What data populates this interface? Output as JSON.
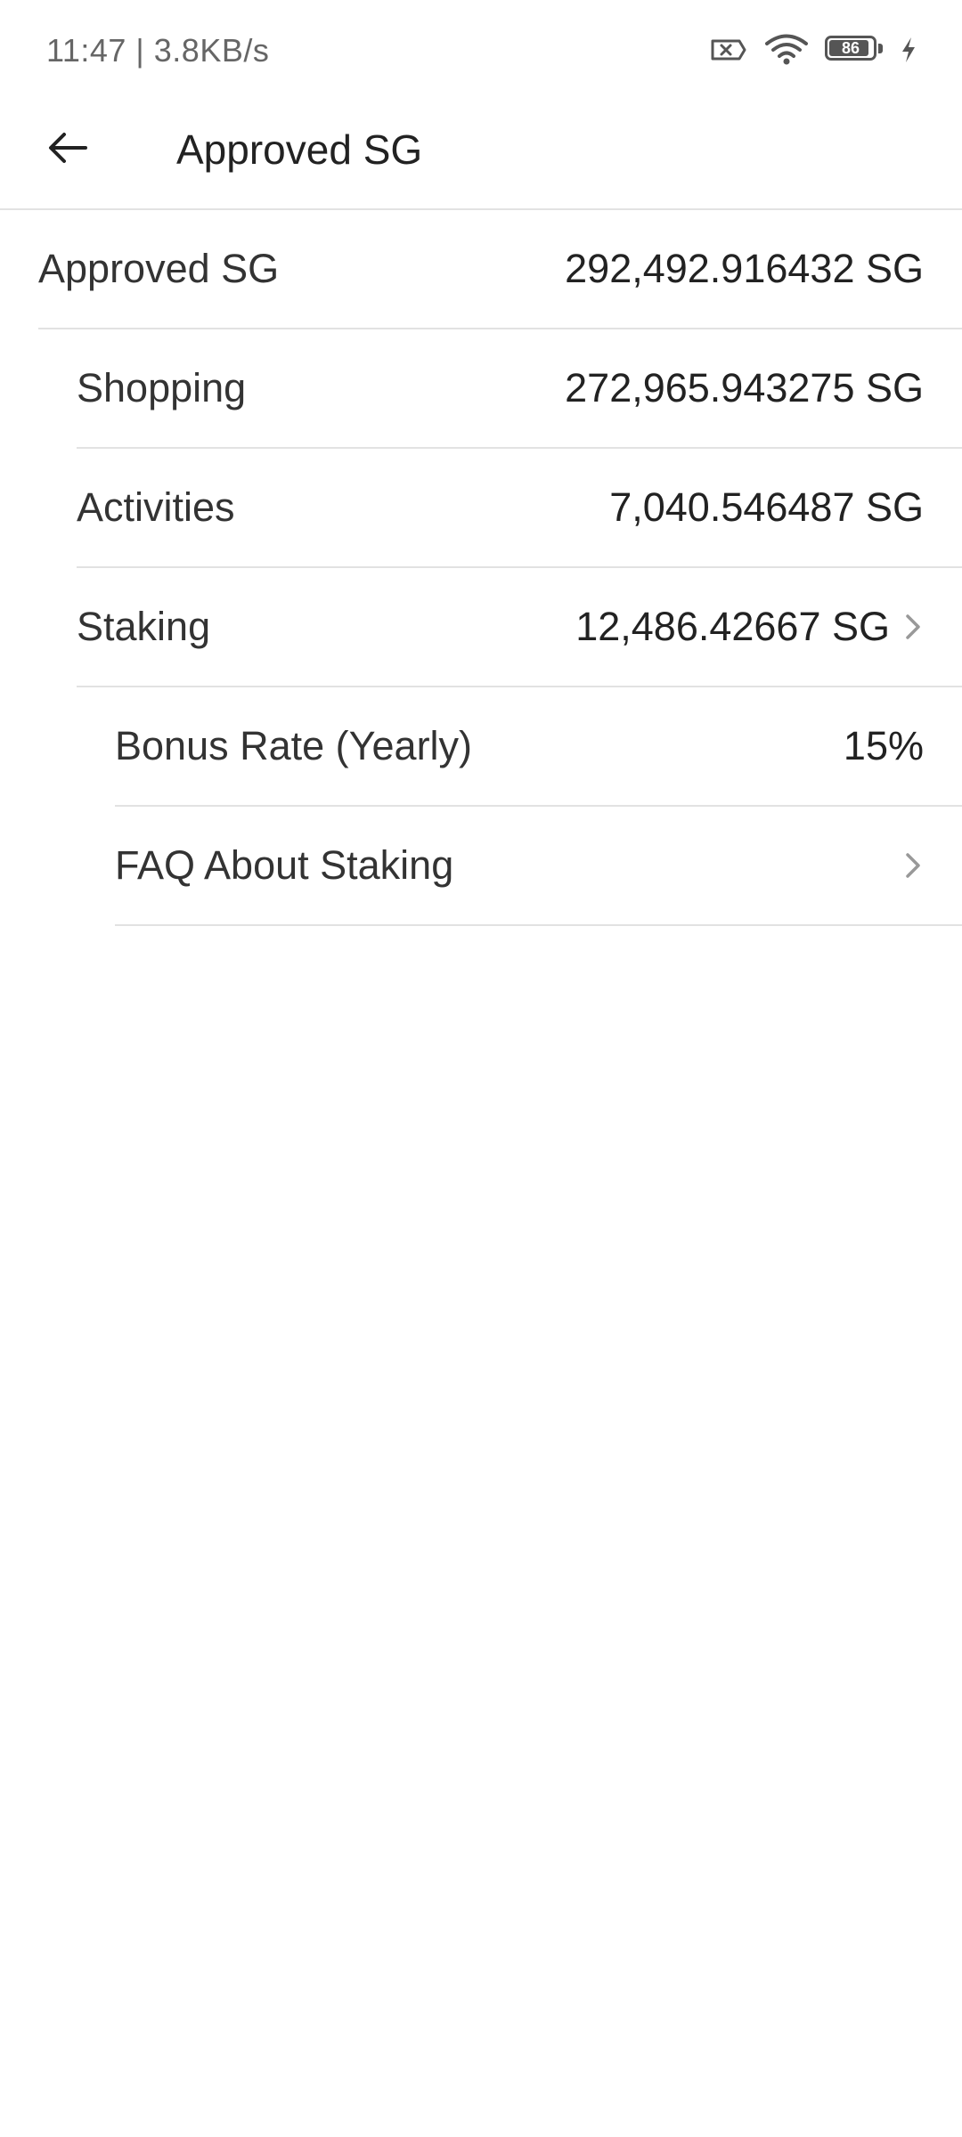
{
  "status_bar": {
    "time_speed": "11:47 | 3.8KB/s",
    "battery_level": "86",
    "icons": [
      "sim-off-icon",
      "wifi-icon",
      "battery-icon",
      "charging-icon"
    ]
  },
  "header": {
    "title": "Approved SG",
    "back_icon": "back-arrow-icon"
  },
  "rows": {
    "approved": {
      "label": "Approved SG",
      "value": "292,492.916432 SG"
    },
    "shopping": {
      "label": "Shopping",
      "value": "272,965.943275 SG"
    },
    "activities": {
      "label": "Activities",
      "value": "7,040.546487 SG"
    },
    "staking": {
      "label": "Staking",
      "value": "12,486.42667 SG"
    },
    "bonus_rate": {
      "label": "Bonus Rate (Yearly)",
      "value": "15%"
    },
    "faq": {
      "label": "FAQ About Staking"
    }
  },
  "colors": {
    "text_primary": "#222222",
    "text_secondary": "#666666",
    "divider": "#e2e2e2",
    "chevron": "#999999",
    "background": "#ffffff"
  }
}
